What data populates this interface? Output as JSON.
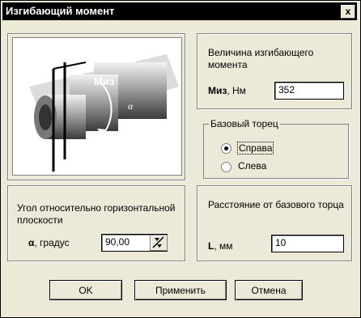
{
  "window": {
    "title": "Изгибающий момент",
    "close_label": "x"
  },
  "illustration": {
    "label": "Миз",
    "alpha": "α"
  },
  "moment": {
    "heading": "Величина изгибающего момента",
    "symbol": "Миз",
    "unit": ", Нм",
    "value": "352"
  },
  "base_face": {
    "title": "Базовый торец",
    "options": [
      {
        "label": "Справа",
        "selected": true
      },
      {
        "label": "Слева",
        "selected": false
      }
    ]
  },
  "distance": {
    "heading": "Расстояние от базового торца",
    "symbol": "L",
    "unit": ", мм",
    "value": "10"
  },
  "angle": {
    "heading": "Угол относительно горизонтальной плоскости",
    "symbol": "α",
    "unit": ", градус",
    "value": "90,00"
  },
  "buttons": {
    "ok": "OK",
    "apply": "Применить",
    "cancel": "Отмена"
  }
}
